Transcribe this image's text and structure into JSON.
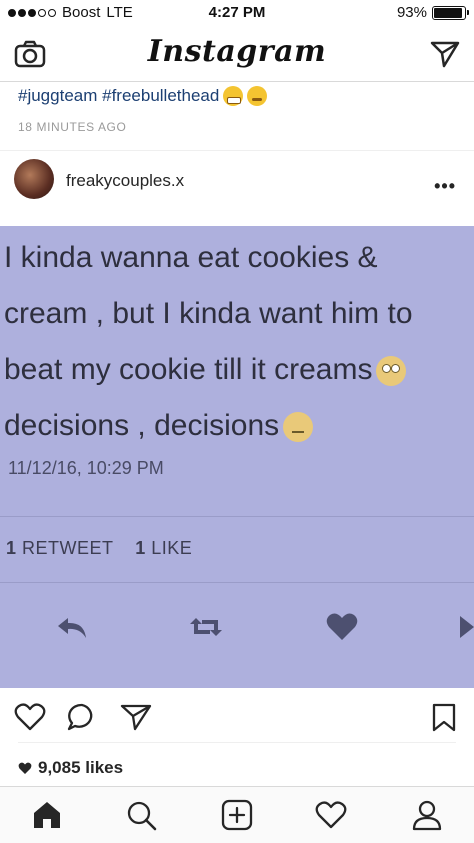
{
  "status_bar": {
    "carrier": "Boost",
    "network": "LTE",
    "time": "4:27 PM",
    "battery_text": "93%",
    "battery_level": 0.93,
    "signal_bars_filled": 3,
    "signal_bars_total": 5
  },
  "top_nav": {
    "brand": "Instagram",
    "left_icon": "camera-icon",
    "right_icon": "send-icon"
  },
  "previous_post": {
    "hashtags": "#juggteam #freebullethead",
    "emojis": [
      "grimacing-face",
      "face-with-steam"
    ],
    "time_ago": "18 MINUTES AGO"
  },
  "post": {
    "username": "freakycouples.x",
    "more_icon": "•••",
    "tweet": {
      "lines": [
        "I kinda wanna eat cookies &",
        "cream , but I kinda want him to",
        "beat my cookie till it creams",
        "decisions , decisions"
      ],
      "emojis": [
        "face-with-rolling-eyes",
        "thinking-face"
      ],
      "date": "11/12/16, 10:29 PM",
      "retweets_count": "1",
      "retweets_label": "RETWEET",
      "likes_count": "1",
      "likes_label": "LIKE",
      "background_color": "#aeb0dd"
    },
    "likes_text": "9,085 likes"
  },
  "tab_bar": {
    "items": [
      "home-icon",
      "search-icon",
      "add-post-icon",
      "activity-heart-icon",
      "profile-icon"
    ]
  }
}
